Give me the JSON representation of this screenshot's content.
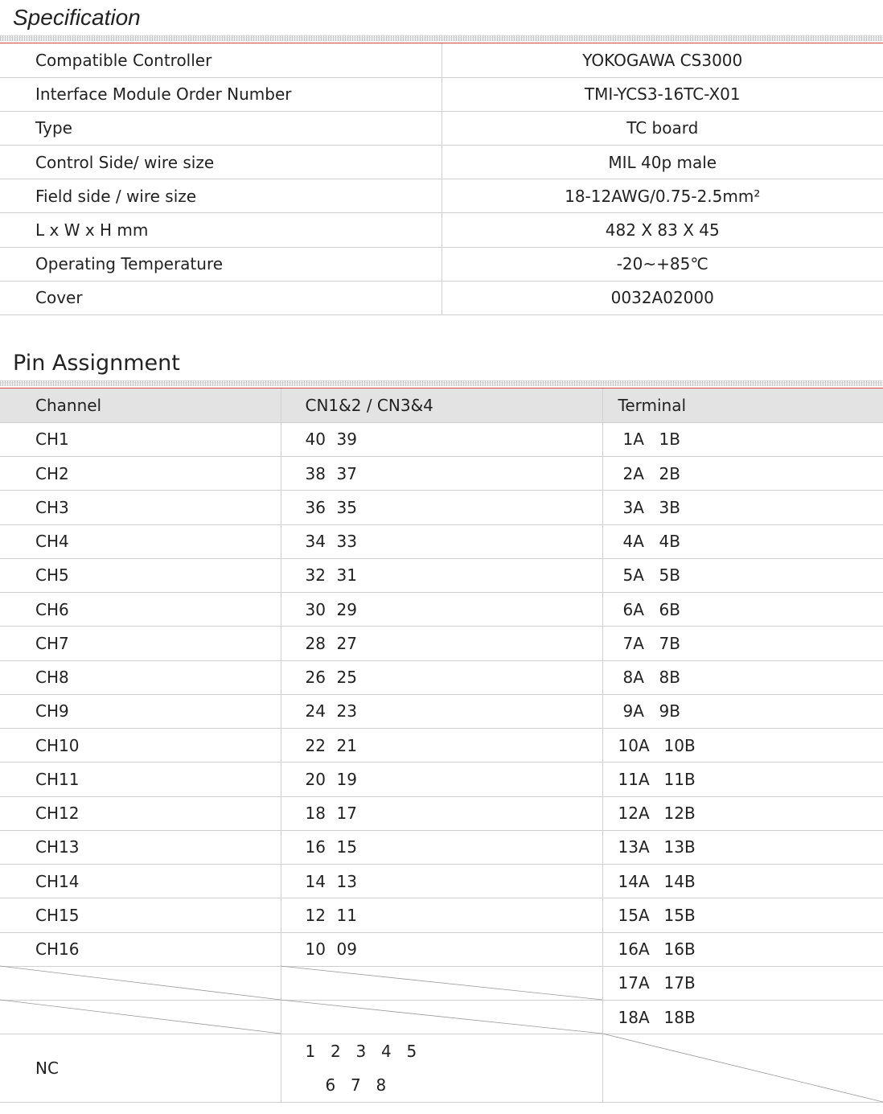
{
  "spec": {
    "title": "Specification",
    "rows": [
      {
        "label": "Compatible Controller",
        "value": "YOKOGAWA CS3000"
      },
      {
        "label": "Interface Module Order Number",
        "value": "TMI-YCS3-16TC-X01"
      },
      {
        "label": "Type",
        "value": "TC board"
      },
      {
        "label": "Control Side/ wire size",
        "value": "MIL 40p male"
      },
      {
        "label": "Field side / wire size",
        "value": "18-12AWG/0.75-2.5mm²"
      },
      {
        "label": "L x W x H mm",
        "value": "482 X 83 X 45"
      },
      {
        "label": "Operating Temperature",
        "value": "-20~+85℃"
      },
      {
        "label": "Cover",
        "value": "0032A02000"
      }
    ]
  },
  "pins": {
    "title": "Pin Assignment",
    "headers": [
      "Channel",
      "CN1&2 / CN3&4",
      "Terminal"
    ],
    "rows": [
      {
        "ch": "CH1",
        "cn": [
          "40",
          "39"
        ],
        "term": [
          "1A",
          "1B"
        ]
      },
      {
        "ch": "CH2",
        "cn": [
          "38",
          "37"
        ],
        "term": [
          "2A",
          "2B"
        ]
      },
      {
        "ch": "CH3",
        "cn": [
          "36",
          "35"
        ],
        "term": [
          "3A",
          "3B"
        ]
      },
      {
        "ch": "CH4",
        "cn": [
          "34",
          "33"
        ],
        "term": [
          "4A",
          "4B"
        ]
      },
      {
        "ch": "CH5",
        "cn": [
          "32",
          "31"
        ],
        "term": [
          "5A",
          "5B"
        ]
      },
      {
        "ch": "CH6",
        "cn": [
          "30",
          "29"
        ],
        "term": [
          "6A",
          "6B"
        ]
      },
      {
        "ch": "CH7",
        "cn": [
          "28",
          "27"
        ],
        "term": [
          "7A",
          "7B"
        ]
      },
      {
        "ch": "CH8",
        "cn": [
          "26",
          "25"
        ],
        "term": [
          "8A",
          "8B"
        ]
      },
      {
        "ch": "CH9",
        "cn": [
          "24",
          "23"
        ],
        "term": [
          "9A",
          "9B"
        ]
      },
      {
        "ch": "CH10",
        "cn": [
          "22",
          "21"
        ],
        "term": [
          "10A",
          "10B"
        ]
      },
      {
        "ch": "CH11",
        "cn": [
          "20",
          "19"
        ],
        "term": [
          "11A",
          "11B"
        ]
      },
      {
        "ch": "CH12",
        "cn": [
          "18",
          "17"
        ],
        "term": [
          "12A",
          "12B"
        ]
      },
      {
        "ch": "CH13",
        "cn": [
          "16",
          "15"
        ],
        "term": [
          "13A",
          "13B"
        ]
      },
      {
        "ch": "CH14",
        "cn": [
          "14",
          "13"
        ],
        "term": [
          "14A",
          "14B"
        ]
      },
      {
        "ch": "CH15",
        "cn": [
          "12",
          "11"
        ],
        "term": [
          "15A",
          "15B"
        ]
      },
      {
        "ch": "CH16",
        "cn": [
          "10",
          "09"
        ],
        "term": [
          "16A",
          "16B"
        ]
      },
      {
        "ch": "",
        "cn": [
          "",
          ""
        ],
        "term": [
          "17A",
          "17B"
        ]
      },
      {
        "ch": "",
        "cn": [
          "",
          ""
        ],
        "term": [
          "18A",
          "18B"
        ]
      }
    ],
    "nc": {
      "label": "NC",
      "line1": [
        "1",
        "2",
        "3",
        "4",
        "5"
      ],
      "line2": [
        "6",
        "7",
        "8"
      ]
    }
  },
  "colors": {
    "accent_rule": "#d9424a",
    "header_bg": "#e3e3e3",
    "grid": "#cfcfcf"
  }
}
